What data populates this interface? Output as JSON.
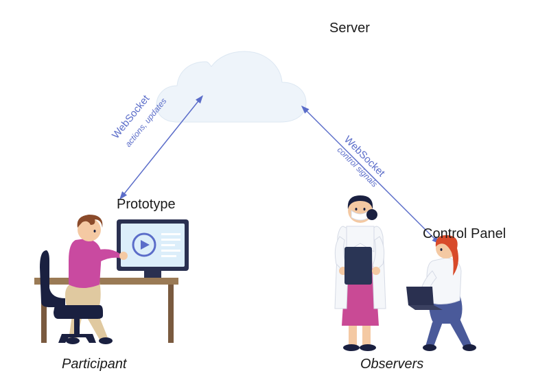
{
  "nodes": {
    "server": {
      "label": "Server"
    },
    "prototype": {
      "label": "Prototype"
    },
    "control_panel": {
      "label": "Control Panel"
    },
    "participant": {
      "label": "Participant"
    },
    "observers": {
      "label": "Observers"
    }
  },
  "connections": {
    "left": {
      "protocol": "WebSocket",
      "detail": "actions, updates"
    },
    "right": {
      "protocol": "WebSocket",
      "detail": "control signals"
    }
  },
  "colors": {
    "arrow": "#5b6dc9",
    "text": "#1a1a1a",
    "cloud_fill": "#eef4fa",
    "cloud_stroke": "#dce7f2",
    "desk": "#7a5a3f",
    "chair": "#1a2040",
    "skin": "#f4c9a3",
    "hair_brown": "#8a4a2a",
    "hair_dark": "#1a2040",
    "hair_red": "#d84a2a",
    "shirt_pink": "#c94aa0",
    "pants_tan": "#e0c9a0",
    "coat_white": "#f5f7fa",
    "dress_magenta": "#c94a95",
    "pants_blue": "#4a5a9a",
    "monitor_bg": "#dceefa",
    "monitor_frame": "#2a3050",
    "laptop": "#2a3050",
    "clipboard": "#2a3555"
  }
}
